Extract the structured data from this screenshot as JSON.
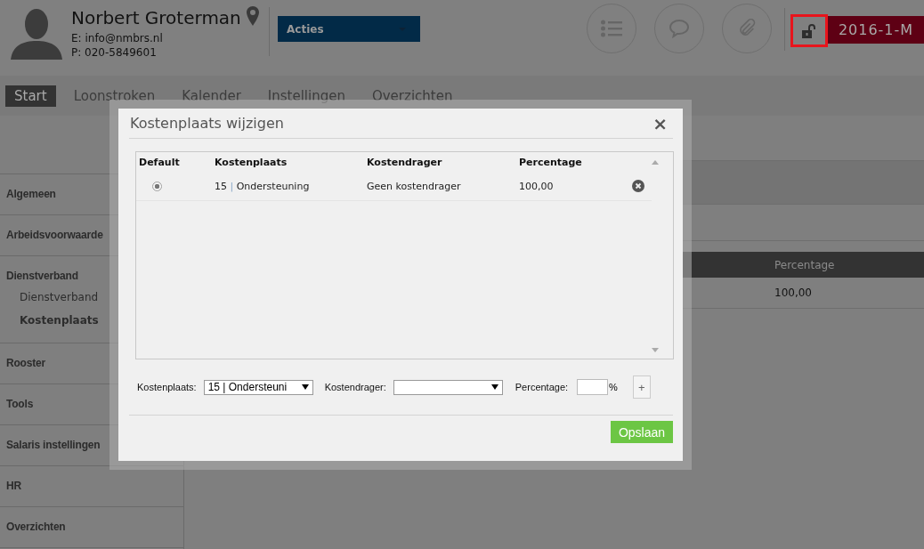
{
  "profile": {
    "name": "Norbert Groterman",
    "email": "E: info@nmbrs.nl",
    "phone": "P: 020-5849601"
  },
  "actions_dropdown": {
    "label": "Acties"
  },
  "period": "2016-1-M",
  "tabs": [
    {
      "label": "Start",
      "selected": true
    },
    {
      "label": "Loonstroken",
      "selected": false
    },
    {
      "label": "Kalender",
      "selected": false
    },
    {
      "label": "Instellingen",
      "selected": false
    },
    {
      "label": "Overzichten",
      "selected": false
    }
  ],
  "sidebar": {
    "items": [
      {
        "label": "Algemeen"
      },
      {
        "label": "Arbeidsvoorwaarde"
      },
      {
        "label": "Dienstverband",
        "children": [
          {
            "label": "Dienstverband",
            "selected": false
          },
          {
            "label": "Kostenplaats",
            "selected": true
          }
        ]
      },
      {
        "label": "Rooster"
      },
      {
        "label": "Tools"
      },
      {
        "label": "Salaris instellingen"
      },
      {
        "label": "HR"
      },
      {
        "label": "Overzichten"
      }
    ]
  },
  "background_table": {
    "columns": [
      "Percentage"
    ],
    "rows": [
      [
        "100,00"
      ]
    ]
  },
  "dialog": {
    "title": "Kostenplaats wijzigen",
    "close": "×",
    "table": {
      "columns": [
        "Default",
        "Kostenplaats",
        "Kostendrager",
        "Percentage"
      ],
      "rows": [
        {
          "default": true,
          "code": "15",
          "separator": "|",
          "name": "Ondersteuning",
          "cost_carrier": "Geen kostendrager",
          "percentage": "100,00"
        }
      ]
    },
    "form": {
      "cost_center_label": "Kostenplaats:",
      "cost_center_value": "15 | Ondersteuni",
      "cost_carrier_label": "Kostendrager:",
      "percentage_label": "Percentage:",
      "percent_sign": "%",
      "add_button": "+"
    },
    "save_button": "Opslaan"
  }
}
